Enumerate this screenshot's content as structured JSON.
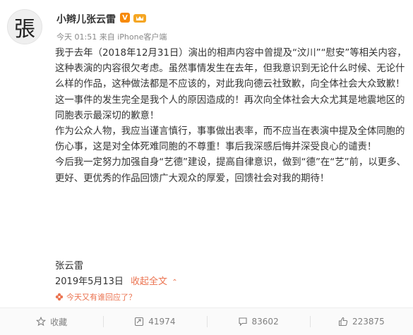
{
  "header": {
    "username": "小辫儿张云雷",
    "verified_badge": "V",
    "avatar_glyph": "張",
    "time": "今天 01:51",
    "source_prefix": "来自",
    "source": "iPhone客户端"
  },
  "post": {
    "paragraphs": [
      "我于去年（2018年12月31日）演出的相声内容中曾提及“汶川”“慰安”等相关内容，这种表演的内容很欠考虑。虽然事情发生在去年，但我意识到无论什么时候、无论什么样的作品，这种做法都是不应该的，对此我向德云社致歉，向全体社会大众致歉！这一事件的发生完全是我个人的原因造成的！再次向全体社会大众尤其是地震地区的同胞表示最深切的歉意！",
      "作为公众人物，我应当谨言慎行，事事做出表率，而不应当在表演中提及全体同胞的伤心事，这是对全体死难同胞的不尊重！事后我深感后悔并深受良心的谴责！",
      "今后我一定努力加强自身“艺德”建设，提高自律意识，做到“德”在“艺”前，以更多、更好、更优秀的作品回馈广大观众的厚爱，回馈社会对我的期待！"
    ],
    "signature": "张云雷",
    "date": "2019年5月13日",
    "collapse_label": "收起全文",
    "collapse_arrow": "⌃"
  },
  "hint": {
    "text": "今天又有谁回应了？"
  },
  "footer": {
    "favorite_label": "收藏",
    "repost_count": "41974",
    "comment_count": "83602",
    "like_count": "223875"
  },
  "colors": {
    "accent": "#eb7350",
    "verified": "#f78a0a",
    "text": "#333333",
    "muted": "#808080"
  }
}
